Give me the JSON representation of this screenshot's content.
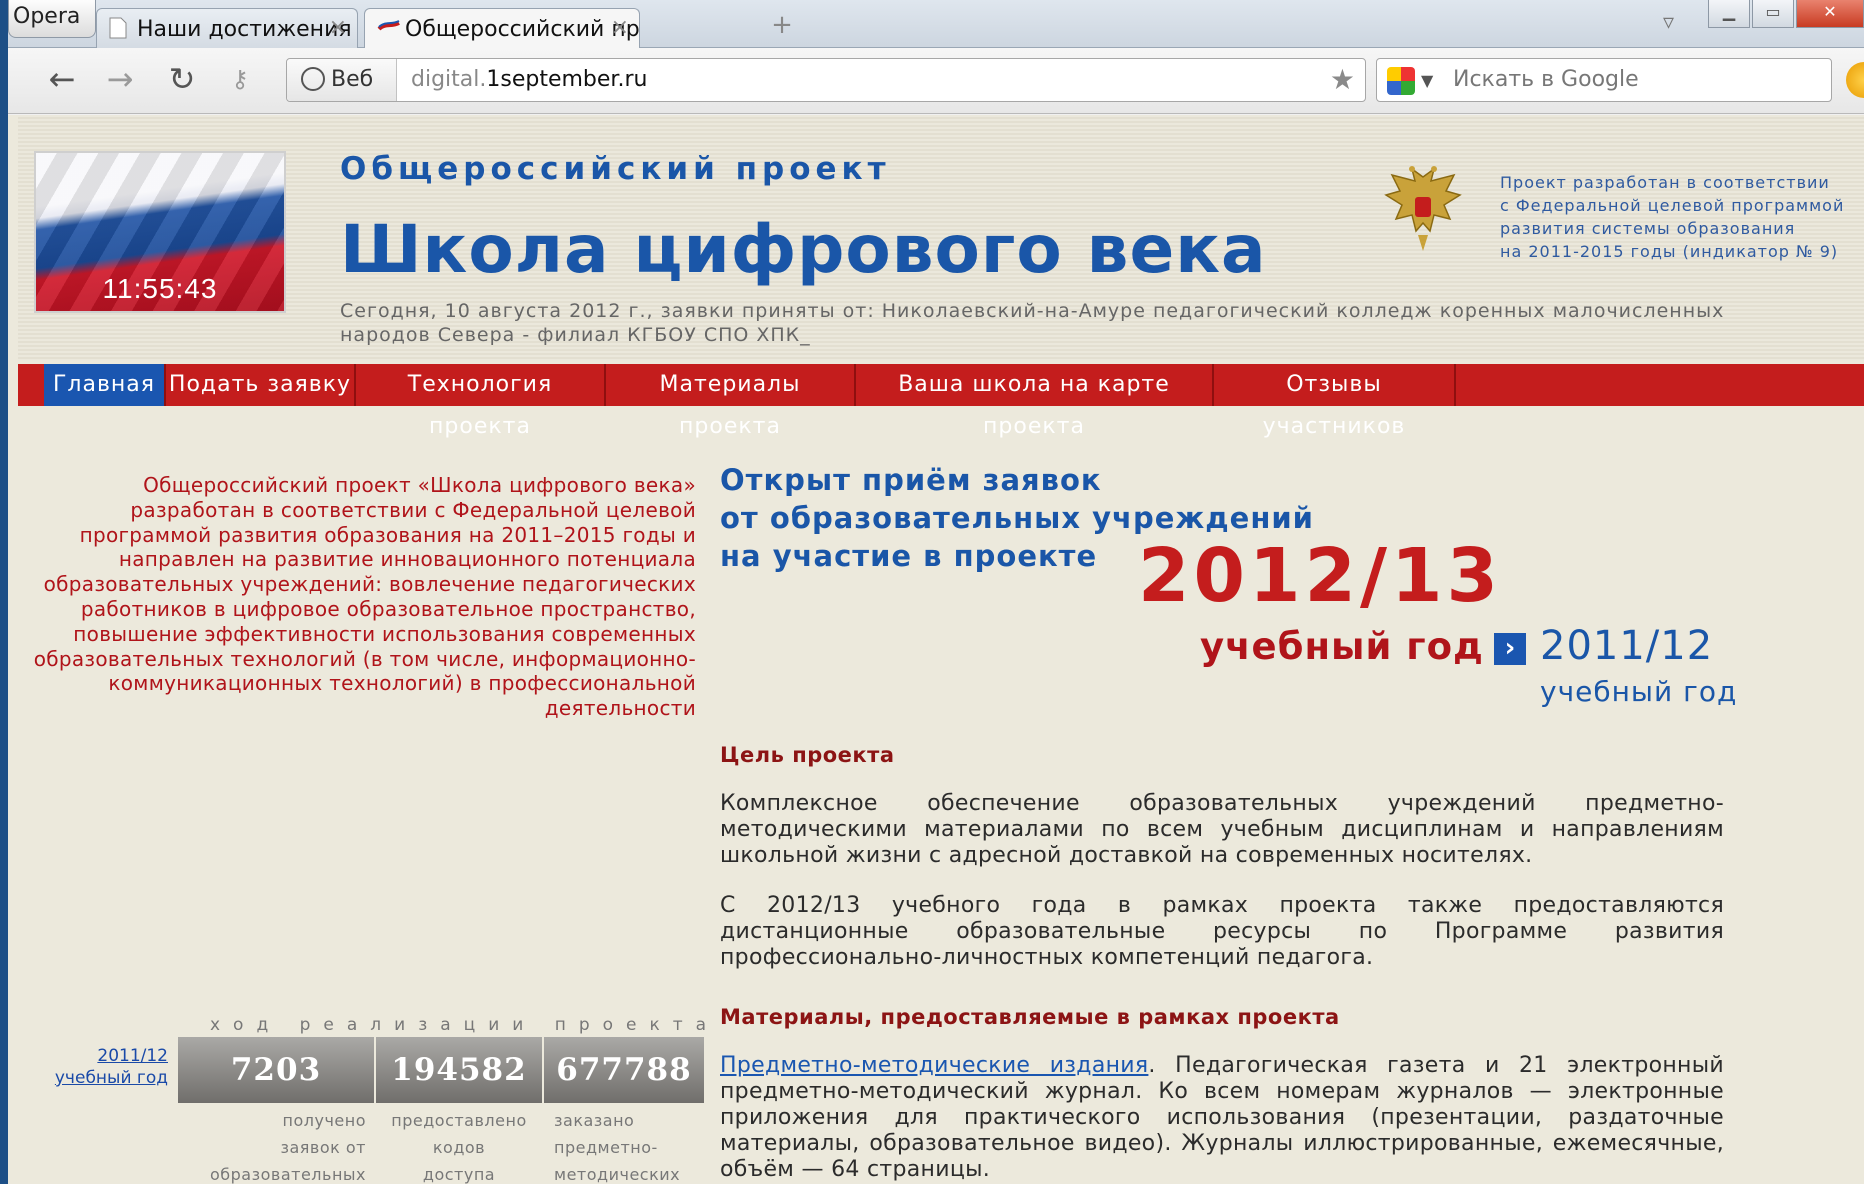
{
  "browser": {
    "menu_label": "Opera",
    "tabs": [
      {
        "title": "Наши достижения - ......"
      },
      {
        "title": "Общероссийский про..."
      }
    ],
    "web_label": "Веб",
    "url_host": "digital.",
    "url_domain": "1september.ru",
    "search_placeholder": "Искать в Google"
  },
  "header": {
    "clock": "11:55:43",
    "subtitle": "Общероссийский проект",
    "title": "Школа цифрового века",
    "today": "Сегодня, 10 августа 2012 г., заявки приняты от: Николаевский-на-Амуре педагогический колледж коренных малочисленных народов Севера - филиал КГБОУ СПО ХПК_",
    "fed_note": [
      "Проект разработан в соответствии",
      "с Федеральной целевой программой",
      "развития системы образования",
      "на 2011-2015 годы (индикатор № 9)"
    ]
  },
  "nav": [
    {
      "label": "Главная",
      "active": true
    },
    {
      "label": "Подать заявку"
    },
    {
      "label": "Технология проекта"
    },
    {
      "label": "Материалы проекта"
    },
    {
      "label": "Ваша школа на карте проекта"
    },
    {
      "label": "Отзывы участников"
    }
  ],
  "intro": "Общероссийский проект «Школа цифрового века» разработан в соответствии с Федеральной целевой программой развития образования на 2011–2015 годы и направлен на развитие инновационного потенциала образовательных учреждений: вовлечение педагогических работников в цифровое образовательное пространство, повышение эффективности использования современных образовательных технологий (в том числе, информационно-коммуникационных технологий) в профессиональной деятельности",
  "progress": {
    "title": "ход реализации проекта",
    "year_link": [
      "2011/12",
      "учебный год"
    ],
    "stats": [
      {
        "value": "7203",
        "label": [
          "получено",
          "заявок от",
          "образовательных"
        ]
      },
      {
        "value": "194582",
        "label": [
          "предоставлено",
          "кодов",
          "доступа"
        ]
      },
      {
        "value": "677788",
        "label": [
          "заказано",
          "предметно-",
          "методических"
        ]
      }
    ]
  },
  "announce": {
    "lines": [
      "Открыт приём заявок",
      "от образовательных учреждений",
      "на участие в проекте"
    ],
    "year": "2012/13",
    "year_label": "учебный год",
    "prev_year": "2011/12",
    "prev_year_label": "учебный год"
  },
  "goal": {
    "heading": "Цель проекта",
    "p1": "Комплексное обеспечение образовательных учреждений предметно-методическими материалами по всем учебным дисциплинам и направлениям школьной жизни с адресной доставкой на современных носителях.",
    "p2": "С 2012/13 учебного года в рамках проекта также предоставляются дистанционные образовательные ресурсы по Программе развития профессионально-личностных компетенций педагога."
  },
  "materials": {
    "heading": "Материалы, предоставляемые в рамках проекта",
    "link": "Предметно-методические издания",
    "text": ". Педагогическая газета и 21 электронный предметно-методический журнал. Ко всем номерам журналов — электронные приложения для практического использования (презентации, раздаточные материалы, образовательное видео). Журналы иллюстрированные, ежемесячные, объём — 64 страницы."
  },
  "colors": {
    "accent_blue": "#1a56a8",
    "accent_red": "#c41d1d"
  },
  "icons": [
    "back-icon",
    "forward-icon",
    "reload-icon",
    "key-icon",
    "globe-icon",
    "star-icon",
    "google-icon",
    "eagle-emblem-icon",
    "arrow-right-icon"
  ]
}
